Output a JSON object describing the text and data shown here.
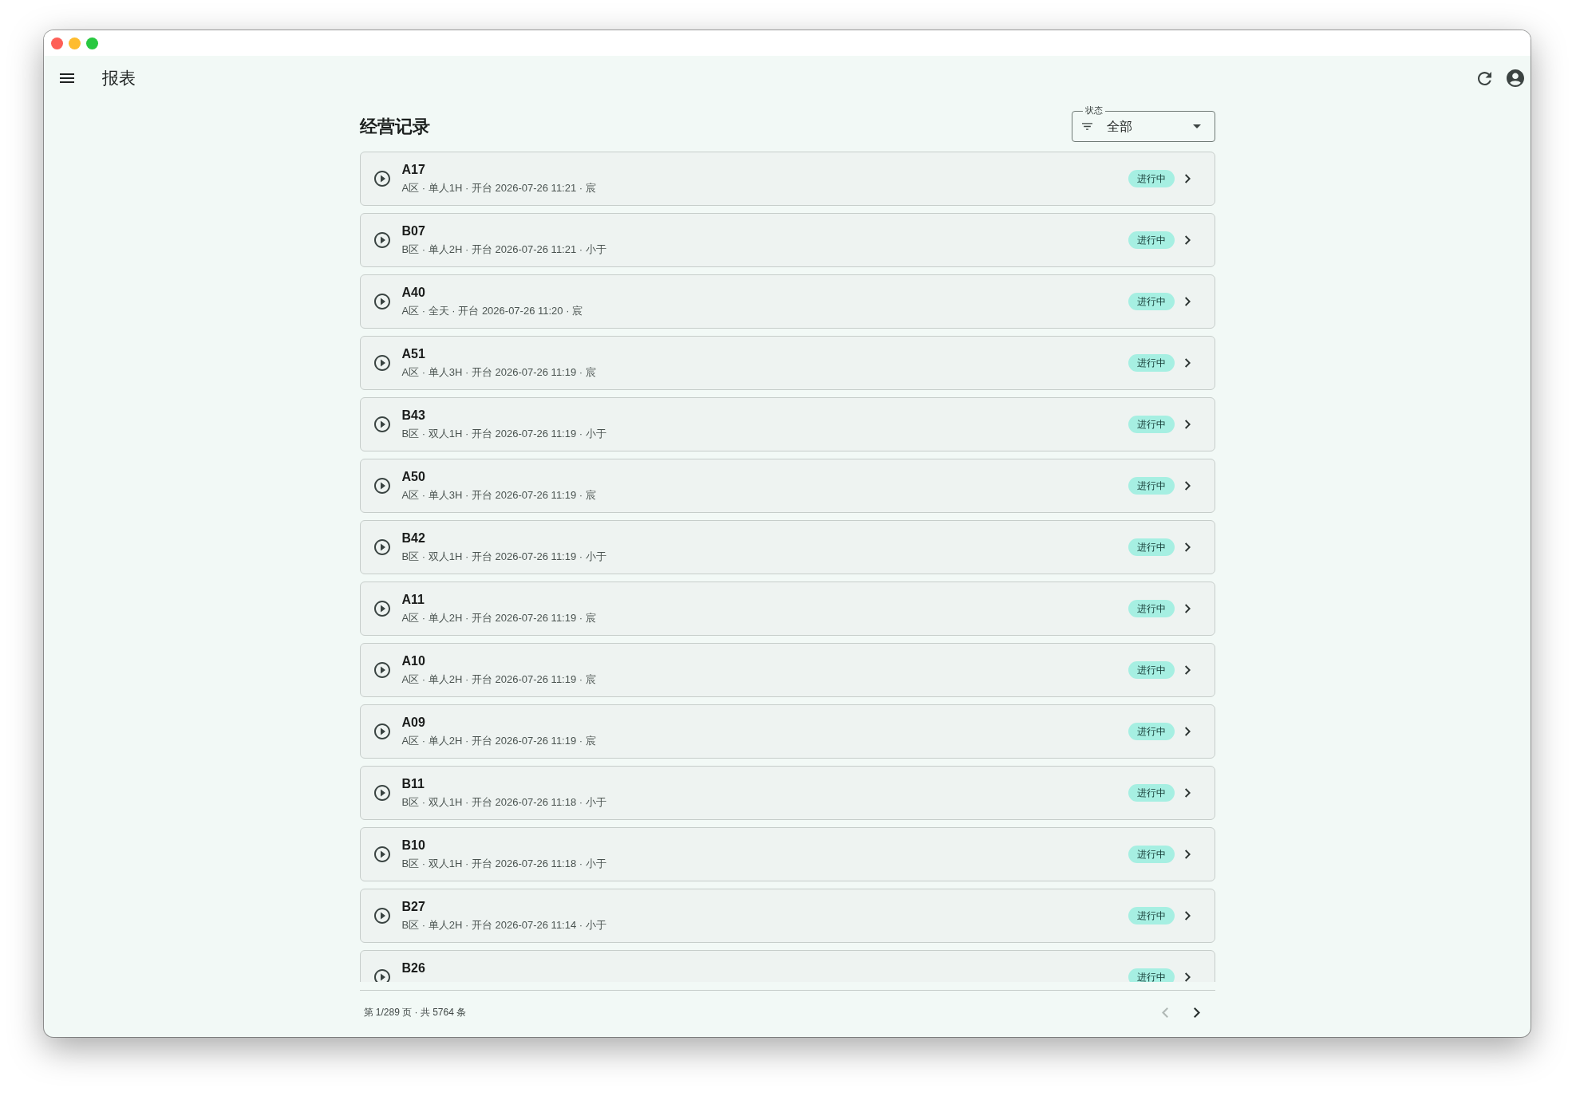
{
  "app_bar": {
    "title": "报表"
  },
  "page": {
    "heading": "经营记录",
    "filter": {
      "label": "状态",
      "value": "全部"
    }
  },
  "records": [
    {
      "title": "A17",
      "details": "A区 · 单人1H · 开台 2026-07-26 11:21 · 宸",
      "status": "进行中"
    },
    {
      "title": "B07",
      "details": "B区 · 单人2H · 开台 2026-07-26 11:21 · 小于",
      "status": "进行中"
    },
    {
      "title": "A40",
      "details": "A区 · 全天 · 开台 2026-07-26 11:20 · 宸",
      "status": "进行中"
    },
    {
      "title": "A51",
      "details": "A区 · 单人3H · 开台 2026-07-26 11:19 · 宸",
      "status": "进行中"
    },
    {
      "title": "B43",
      "details": "B区 · 双人1H · 开台 2026-07-26 11:19 · 小于",
      "status": "进行中"
    },
    {
      "title": "A50",
      "details": "A区 · 单人3H · 开台 2026-07-26 11:19 · 宸",
      "status": "进行中"
    },
    {
      "title": "B42",
      "details": "B区 · 双人1H · 开台 2026-07-26 11:19 · 小于",
      "status": "进行中"
    },
    {
      "title": "A11",
      "details": "A区 · 单人2H · 开台 2026-07-26 11:19 · 宸",
      "status": "进行中"
    },
    {
      "title": "A10",
      "details": "A区 · 单人2H · 开台 2026-07-26 11:19 · 宸",
      "status": "进行中"
    },
    {
      "title": "A09",
      "details": "A区 · 单人2H · 开台 2026-07-26 11:19 · 宸",
      "status": "进行中"
    },
    {
      "title": "B11",
      "details": "B区 · 双人1H · 开台 2026-07-26 11:18 · 小于",
      "status": "进行中"
    },
    {
      "title": "B10",
      "details": "B区 · 双人1H · 开台 2026-07-26 11:18 · 小于",
      "status": "进行中"
    },
    {
      "title": "B27",
      "details": "B区 · 单人2H · 开台 2026-07-26 11:14 · 小于",
      "status": "进行中"
    },
    {
      "title": "B26",
      "status": "进行中"
    }
  ],
  "pagination": {
    "summary": "第 1/289 页 · 共 5764 条",
    "buttons": [
      {
        "kind": "prev",
        "disabled": true
      },
      {
        "kind": "next",
        "disabled": false
      }
    ]
  }
}
